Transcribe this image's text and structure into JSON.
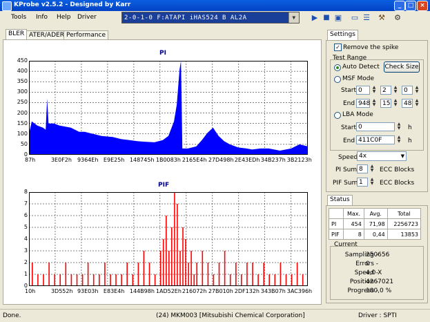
{
  "window": {
    "title": "KProbe v2.5.2 - Designed by Karr",
    "minimize": "_",
    "maximize": "□",
    "close": "×"
  },
  "menu": {
    "items": [
      "Tools",
      "Info",
      "Help",
      "Driver"
    ]
  },
  "device": {
    "selected": "2-0-1-0 F:ATAPI   iHAS524   B    AL2A"
  },
  "tabs": [
    "BLER",
    "ATER/ADER",
    "Performance"
  ],
  "settings_tab": "Settings",
  "status_tab": "Status",
  "settings": {
    "remove_spike_label": "Remove the spike",
    "remove_spike_checked": true,
    "test_range_title": "Test Range",
    "auto_detect_label": "Auto Detect",
    "check_size_label": "Check Size",
    "msf_mode_label": "MSF Mode",
    "start_label": "Start",
    "end_label": "End",
    "msf_start": [
      "0",
      "2",
      "0"
    ],
    "msf_end": [
      "948",
      "15",
      "48"
    ],
    "lba_mode_label": "LBA Mode",
    "lba_start": "0",
    "lba_end": "411C0F",
    "unit_h": "h",
    "speed_label": "Speed",
    "speed_value": "4x",
    "pi_sum_label": "PI Sum",
    "pi_sum_value": "8",
    "pif_sum_label": "PIF Sum",
    "pif_sum_value": "1",
    "ecc_blocks_label": "ECC Blocks"
  },
  "status": {
    "headers": [
      "",
      "Max.",
      "Avg.",
      "Total"
    ],
    "rows": [
      {
        "name": "PI",
        "max": "454",
        "avg": "71,98",
        "total": "2256723"
      },
      {
        "name": "PIF",
        "max": "8",
        "avg": "0,44",
        "total": "13853"
      }
    ],
    "current_title": "Current",
    "sampling_label": "Sampling -",
    "sampling_value": "250656",
    "errors_label": "Errors -",
    "errors_value": "0",
    "speed_label": "Speed -",
    "speed_value": "4,0  X",
    "position_label": "Position -",
    "position_value": "4267021",
    "progress_label": "Progress -",
    "progress_value": "100,0 %"
  },
  "statusbar": {
    "left": "Done.",
    "center": "(24) MKM003 [Mitsubishi Chemical Corporation]",
    "right": "Driver : SPTI"
  },
  "colors": {
    "pi_fill": "#0000ff",
    "pif_fill": "#ff0000",
    "grid": "#000000"
  },
  "chart_data": [
    {
      "type": "area",
      "title": "PI",
      "ylim": [
        0,
        450
      ],
      "yticks": [
        0,
        50,
        100,
        150,
        200,
        250,
        300,
        350,
        400,
        450
      ],
      "xticks": [
        "87h",
        "3E0F2h",
        "9364Eh",
        "E9E25h",
        "148745h",
        "1B0083h",
        "2165E4h",
        "27D498h",
        "2E43EDh",
        "34B237h",
        "3B2123h"
      ],
      "x": [
        0,
        0.01,
        0.03,
        0.05,
        0.06,
        0.065,
        0.07,
        0.09,
        0.11,
        0.13,
        0.15,
        0.18,
        0.2,
        0.23,
        0.26,
        0.3,
        0.33,
        0.36,
        0.39,
        0.42,
        0.45,
        0.48,
        0.5,
        0.52,
        0.53,
        0.54,
        0.545,
        0.55,
        0.57,
        0.6,
        0.62,
        0.64,
        0.66,
        0.68,
        0.7,
        0.72,
        0.75,
        0.78,
        0.8,
        0.83,
        0.86,
        0.9,
        0.94,
        0.97,
        1.0
      ],
      "values": [
        100,
        160,
        140,
        130,
        120,
        270,
        150,
        150,
        140,
        135,
        130,
        110,
        110,
        100,
        90,
        85,
        75,
        70,
        65,
        62,
        60,
        70,
        90,
        160,
        240,
        410,
        450,
        30,
        30,
        40,
        70,
        105,
        130,
        90,
        65,
        50,
        35,
        30,
        25,
        30,
        30,
        20,
        30,
        50,
        40
      ]
    },
    {
      "type": "bar",
      "title": "PIF",
      "ylim": [
        0,
        8
      ],
      "yticks": [
        0,
        1,
        2,
        3,
        4,
        5,
        6,
        7,
        8
      ],
      "xticks": [
        "10h",
        "3D552h",
        "93E03h",
        "E83E4h",
        "144B98h",
        "1AD52Eh",
        "216072h",
        "27B010h",
        "2DF132h",
        "343B07h",
        "3AC396h"
      ],
      "x": [
        0.01,
        0.03,
        0.05,
        0.07,
        0.09,
        0.11,
        0.13,
        0.15,
        0.17,
        0.19,
        0.21,
        0.23,
        0.25,
        0.27,
        0.29,
        0.31,
        0.33,
        0.35,
        0.37,
        0.39,
        0.41,
        0.43,
        0.45,
        0.47,
        0.48,
        0.49,
        0.5,
        0.51,
        0.52,
        0.53,
        0.54,
        0.55,
        0.56,
        0.57,
        0.58,
        0.59,
        0.6,
        0.62,
        0.64,
        0.66,
        0.68,
        0.7,
        0.72,
        0.74,
        0.76,
        0.78,
        0.8,
        0.82,
        0.84,
        0.86,
        0.88,
        0.9,
        0.92,
        0.94,
        0.96,
        0.98
      ],
      "values": [
        2,
        1,
        1,
        2,
        1,
        1,
        2,
        1,
        1,
        1,
        2,
        1,
        1,
        2,
        1,
        1,
        1,
        2,
        1,
        2,
        3,
        2,
        1,
        3,
        4,
        6,
        3,
        5,
        8,
        7,
        3,
        5,
        4,
        2,
        3,
        1,
        2,
        3,
        2,
        1,
        2,
        3,
        1,
        2,
        1,
        2,
        2,
        1,
        2,
        1,
        1,
        2,
        1,
        1,
        2,
        1
      ]
    }
  ]
}
